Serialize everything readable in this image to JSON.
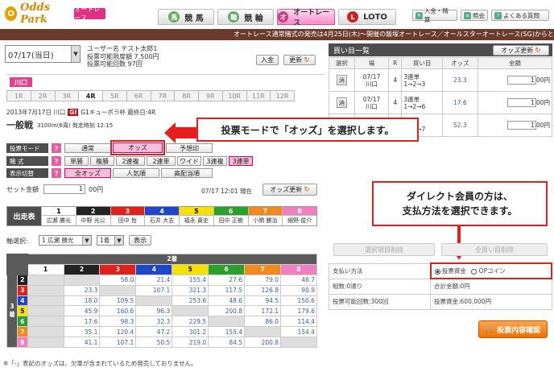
{
  "header": {
    "logo_text": "Odds Park",
    "logo_sub": "オートレース",
    "tabs": [
      {
        "label": "競 馬",
        "icon": "horse-icon"
      },
      {
        "label": "競 輪",
        "icon": "bicycle-icon"
      },
      {
        "label": "オートレース",
        "icon": "motorbike-icon"
      },
      {
        "label": "LOTO",
        "icon": "loto-icon"
      }
    ],
    "buttons": [
      "入金・精算",
      "照会",
      "よくある質問"
    ]
  },
  "ticker": "オートレース通常賭式の発売は4月25日(木)～開催の飯塚オートレース／オールスターオートレース(SG)からとなります。24E",
  "date_select": "07/17(当日)",
  "user": {
    "name_line": "ユーザー名 テスト太郎1",
    "limit_line": "投票可能限度額 7,500円",
    "count_line": "投票可能回数 97回"
  },
  "deposit_button": "入金",
  "refresh_button": "更新",
  "venue": "川口",
  "races": [
    "1R",
    "2R",
    "3R",
    "4R",
    "5R",
    "6R",
    "7R",
    "8R",
    "9R",
    "10R",
    "11R",
    "12R"
  ],
  "race_info": {
    "date_line": "2013年7月17日  川口",
    "grade": "GI",
    "race_name": "G1キューポラ杯  最終日:4R",
    "title": "一般戦",
    "detail": "3100m(6周)  発走時刻 12:15"
  },
  "bet_mode": {
    "label": "投票モード",
    "options": [
      "通常",
      "オッズ",
      "予想印"
    ],
    "selected": "オッズ"
  },
  "bet_type": {
    "label": "賭 式",
    "options": [
      "単勝",
      "複勝",
      "2連複",
      "2連単",
      "ワイド",
      "3連複",
      "3連単"
    ]
  },
  "display": {
    "label": "表示切替",
    "options": [
      "全オッズ",
      "人気順",
      "高配当順"
    ]
  },
  "set_amount": {
    "label": "セット金額",
    "value": "1",
    "unit": "00円"
  },
  "odds_time": "07/17 12:01 現在",
  "odds_refresh": "オッズ更新",
  "callout_mode": "投票モードで「オッズ」を選択します。",
  "callout_direct": "ダイレクト会員の方は、\n支払方法を選択できます。",
  "entries_label": "出走表",
  "entries": [
    {
      "no": "1",
      "name": "広瀬 勝光",
      "bg": "#ffffff",
      "fg": "#000000"
    },
    {
      "no": "2",
      "name": "中野 光公",
      "bg": "#222222",
      "fg": "#ffffff"
    },
    {
      "no": "3",
      "name": "田中 哲",
      "bg": "#e0201c",
      "fg": "#ffffff"
    },
    {
      "no": "4",
      "name": "石井 大志",
      "bg": "#1e46c8",
      "fg": "#ffffff"
    },
    {
      "no": "5",
      "name": "福永 貴史",
      "bg": "#f5e000",
      "fg": "#000000"
    },
    {
      "no": "6",
      "name": "田中 正樹",
      "bg": "#2ca02c",
      "fg": "#ffffff"
    },
    {
      "no": "7",
      "name": "小関 勝治",
      "bg": "#f08a1c",
      "fg": "#ffffff"
    },
    {
      "no": "8",
      "name": "細野 俊介",
      "bg": "#f080c0",
      "fg": "#ffffff"
    }
  ],
  "axis": {
    "label": "軸選択:",
    "first": "1 広瀬 勝光",
    "place": "1着",
    "button": "表示"
  },
  "odds_table": {
    "second_label": "2着",
    "third_label": "3着",
    "cols": [
      "1",
      "2",
      "3",
      "4",
      "5",
      "6",
      "7",
      "8"
    ],
    "rows": [
      {
        "no": "2",
        "vals": [
          "",
          "",
          "58.0",
          "21.4",
          "155.4",
          "27.6",
          "79.0",
          "46.7"
        ]
      },
      {
        "no": "3",
        "vals": [
          "",
          "23.3",
          "",
          "107.1",
          "321.3",
          "117.5",
          "126.8",
          "90.9"
        ]
      },
      {
        "no": "4",
        "vals": [
          "",
          "18.0",
          "109.5",
          "",
          "253.6",
          "48.6",
          "94.5",
          "150.6"
        ]
      },
      {
        "no": "5",
        "vals": [
          "",
          "45.9",
          "160.6",
          "96.3",
          "",
          "200.8",
          "172.1",
          "179.6"
        ]
      },
      {
        "no": "6",
        "vals": [
          "",
          "17.6",
          "98.3",
          "32.3",
          "229.5",
          "",
          "86.0",
          "114.4"
        ]
      },
      {
        "no": "7",
        "vals": [
          "",
          "35.1",
          "120.4",
          "47.2",
          "301.2",
          "155.4",
          "",
          "154.4"
        ]
      },
      {
        "no": "8",
        "vals": [
          "",
          "41.1",
          "107.1",
          "50.5",
          "219.0",
          "84.5",
          "200.8",
          ""
        ]
      }
    ]
  },
  "footnote": "※「-」表記のオッズは、欠車が含まれているため発売しておりません。",
  "bet_list": {
    "title": "買い目一覧",
    "refresh": "オッズ更新",
    "headers": [
      "選択",
      "場",
      "R",
      "買い目",
      "オッズ",
      "金額"
    ],
    "rows": [
      {
        "sel": "消",
        "date": "07/17",
        "venue": "川口",
        "race": "4",
        "bet1": "3連単",
        "bet2": "1→2→3",
        "odds": "23.3",
        "amount": "1",
        "unit": "00円"
      },
      {
        "sel": "消",
        "date": "07/17",
        "venue": "川口",
        "race": "4",
        "bet1": "3連単",
        "bet2": "1→2→6",
        "odds": "17.6",
        "amount": "1",
        "unit": "00円"
      },
      {
        "sel": "消",
        "date": "07/17",
        "venue": "川口",
        "race": "4",
        "bet1": "3連単",
        "bet2": "1→2→7",
        "odds": "52.3",
        "amount": "1",
        "unit": "00円"
      }
    ]
  },
  "delete_selected": "選択項目削除",
  "delete_all": "全買い目削除",
  "payment": {
    "method_label": "支払い方法",
    "method_a": "投票資金",
    "method_b": "OPコイン",
    "sets_label": "組数:0通り",
    "total_label": "合計金額:0円",
    "count_label": "投票可能回数:300回",
    "funds_label": "投票資金:600,000円"
  },
  "confirm_button": "投票内容確認"
}
